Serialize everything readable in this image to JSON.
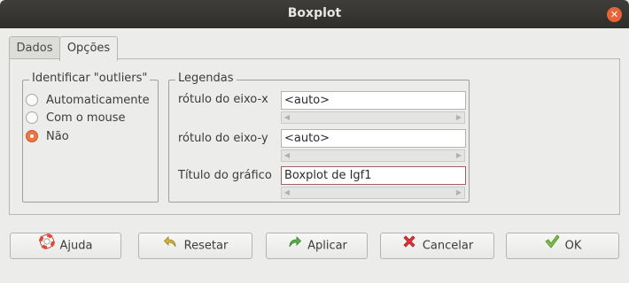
{
  "window": {
    "title": "Boxplot",
    "close_symbol": "✕"
  },
  "tabs": [
    {
      "label": "Dados",
      "active": false
    },
    {
      "label": "Opções",
      "active": true
    }
  ],
  "outliers": {
    "legend": "Identificar \"outliers\"",
    "options": [
      {
        "label": "Automaticamente",
        "checked": false
      },
      {
        "label": "Com o mouse",
        "checked": false
      },
      {
        "label": "Não",
        "checked": true
      }
    ]
  },
  "legends": {
    "legend": "Legendas",
    "fields": [
      {
        "label": "rótulo do eixo-x",
        "value": "<auto>"
      },
      {
        "label": "rótulo do eixo-y",
        "value": "<auto>"
      },
      {
        "label": "Título do gráfico",
        "value": "Boxplot de Igf1"
      }
    ]
  },
  "buttons": {
    "help": "Ajuda",
    "reset": "Resetar",
    "apply": "Aplicar",
    "cancel": "Cancelar",
    "ok": "OK"
  },
  "colors": {
    "accent_radio": "#ee7444",
    "titlebar": "#2f2e2b",
    "close": "#ea6337"
  },
  "icons": [
    "close-icon",
    "lifebuoy-icon",
    "undo-arrow-icon",
    "redo-arrow-icon",
    "x-mark-icon",
    "check-mark-icon"
  ]
}
